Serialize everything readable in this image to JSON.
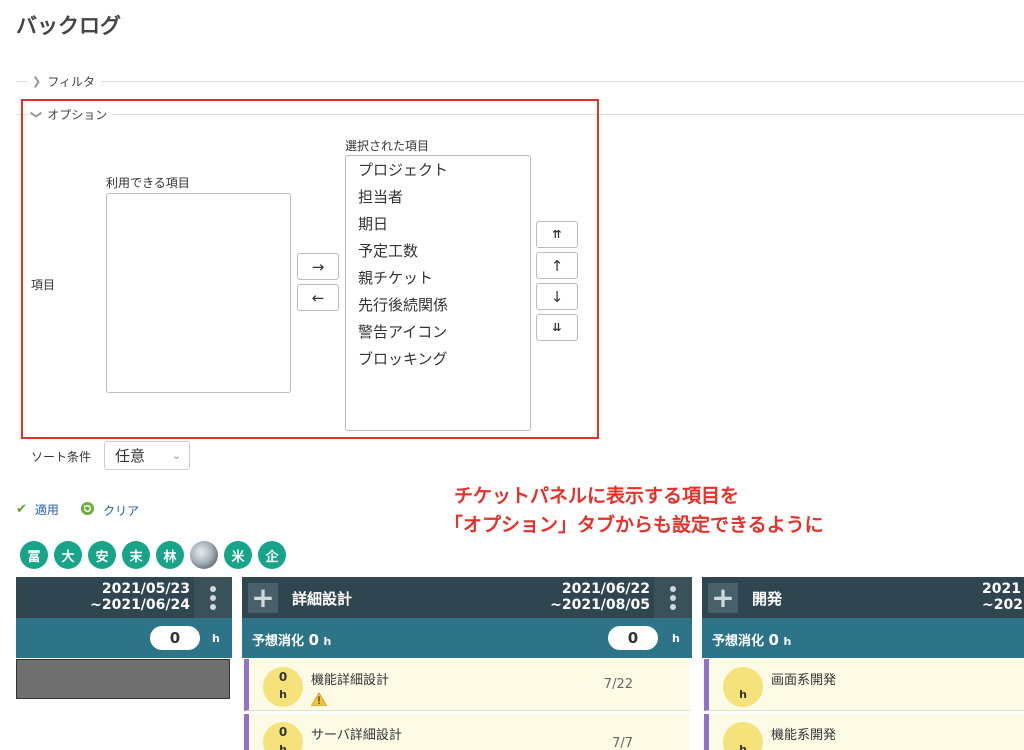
{
  "page": {
    "title": "バックログ"
  },
  "filter": {
    "label": "フィルタ"
  },
  "options": {
    "label": "オプション",
    "items_label": "項目",
    "available_label": "利用できる項目",
    "selected_label": "選択された項目",
    "selected_items": [
      "プロジェクト",
      "担当者",
      "期日",
      "予定工数",
      "親チケット",
      "先行後続関係",
      "警告アイコン",
      "ブロッキング"
    ],
    "add_button": "→",
    "remove_button": "←",
    "move_top": "⇈",
    "move_up": "↑",
    "move_down": "↓",
    "move_bottom": "⇊"
  },
  "sort": {
    "label": "ソート条件",
    "value": "任意"
  },
  "actions": {
    "apply": "適用",
    "clear": "クリア"
  },
  "annotation": {
    "line1": "チケットパネルに表示する項目を",
    "line2": "「オプション」タブからも設定できるように",
    "color": "#e8302a"
  },
  "users": [
    "冨",
    "大",
    "安",
    "末",
    "林",
    "",
    "米",
    "企"
  ],
  "columns": [
    {
      "name": "",
      "date_start": "2021/05/23",
      "date_end": "~2021/06/24",
      "estimate_label": "",
      "hours": "0",
      "unit": "h"
    },
    {
      "name": "詳細設計",
      "date_start": "2021/06/22",
      "date_end": "~2021/08/05",
      "estimate_label": "予想消化",
      "estimate_value": "0",
      "estimate_unit": "h",
      "hours": "0",
      "unit": "h",
      "cards": [
        {
          "hours": "0",
          "unit": "h",
          "title": "機能詳細設計",
          "progress": "7/22",
          "warning": true
        },
        {
          "hours": "0",
          "unit": "h",
          "title": "サーバ詳細設計",
          "progress": "7/7",
          "warning": false
        }
      ]
    },
    {
      "name": "開発",
      "date_start": "2021",
      "date_end": "~202",
      "estimate_label": "予想消化",
      "estimate_value": "0",
      "estimate_unit": "h",
      "cards": [
        {
          "hours": "",
          "unit": "h",
          "title": "画面系開発"
        },
        {
          "hours": "",
          "unit": "h",
          "title": "機能系開発"
        }
      ]
    }
  ],
  "colors": {
    "accent_red": "#e8302a",
    "column_header": "#2f4650",
    "column_sub": "#2e7488",
    "avatar": "#17a589",
    "card": "#fdfbe6",
    "card_border": "#9370c9"
  }
}
